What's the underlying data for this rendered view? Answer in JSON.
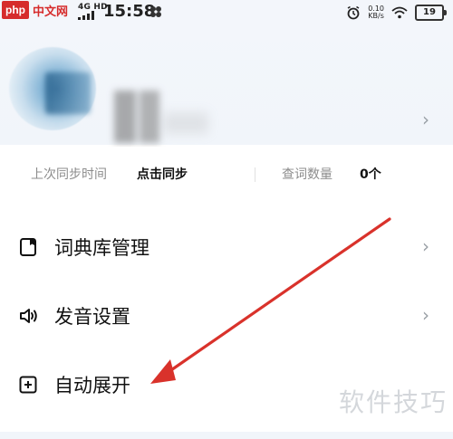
{
  "status_bar": {
    "watermark_badge": "php",
    "watermark_text": "中文网",
    "signal_text": "4G HD",
    "time": "15:58",
    "net_speed_value": "0.10",
    "net_speed_unit": "KB/s",
    "battery": "19",
    "icons": [
      "pinwheel-icon",
      "alarm-icon",
      "wifi-icon",
      "battery-icon"
    ]
  },
  "profile": {
    "chevron": "›"
  },
  "sync": {
    "last_sync_label": "上次同步时间",
    "last_sync_action": "点击同步",
    "lookup_count_label": "查词数量",
    "lookup_count_value": "0个"
  },
  "menu": [
    {
      "label": "词典库管理",
      "icon": "book-icon",
      "chevron": "›"
    },
    {
      "label": "发音设置",
      "icon": "speaker-icon",
      "chevron": "›"
    },
    {
      "label": "自动展开",
      "icon": "expand-icon"
    }
  ],
  "watermark": "软件技巧",
  "colors": {
    "page_background": "#f3f6fb",
    "card_background": "#ffffff",
    "arrow": "#d9322b",
    "label_gray": "#8c8c8c",
    "chevron_gray": "#9aa0a6"
  }
}
